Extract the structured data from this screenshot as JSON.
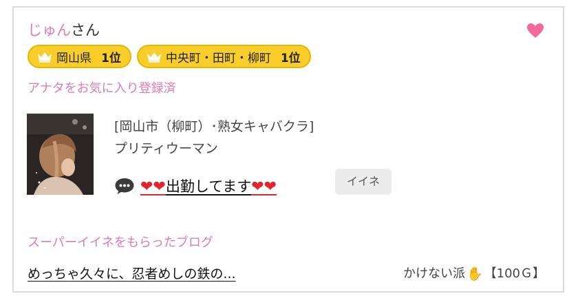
{
  "user": {
    "name": "じゅん",
    "honorific": "さん"
  },
  "badges": [
    {
      "area": "岡山県",
      "rank": "1位"
    },
    {
      "area": "中央町・田町・柳町",
      "rank": "1位"
    }
  ],
  "favorite_status": "アナタをお気に入り登録済",
  "shop": {
    "category": "[岡山市（柳町）･熟女キャバクラ]",
    "name": "プリティウーマン"
  },
  "message": {
    "hearts_before": "❤❤",
    "text": "出勤してます",
    "hearts_after": "❤❤"
  },
  "like_button": "イイネ",
  "super_like_section_title": "スーパーイイネをもらったブログ",
  "blog": {
    "title": "めっちゃ久々に、忍者めしの鉄の...",
    "author": "かけない派",
    "points": "【100Ｇ】"
  },
  "colors": {
    "accent_pink": "#e07ab5",
    "badge_yellow": "#f9cd2a",
    "heart_red": "#e0252f",
    "favorite_heart": "#f06b9c"
  },
  "icons": {
    "favorite": "heart-icon",
    "badge": "crown-icon",
    "message": "speech-bubble-icon",
    "author_emoji": "raised-hand-icon"
  }
}
